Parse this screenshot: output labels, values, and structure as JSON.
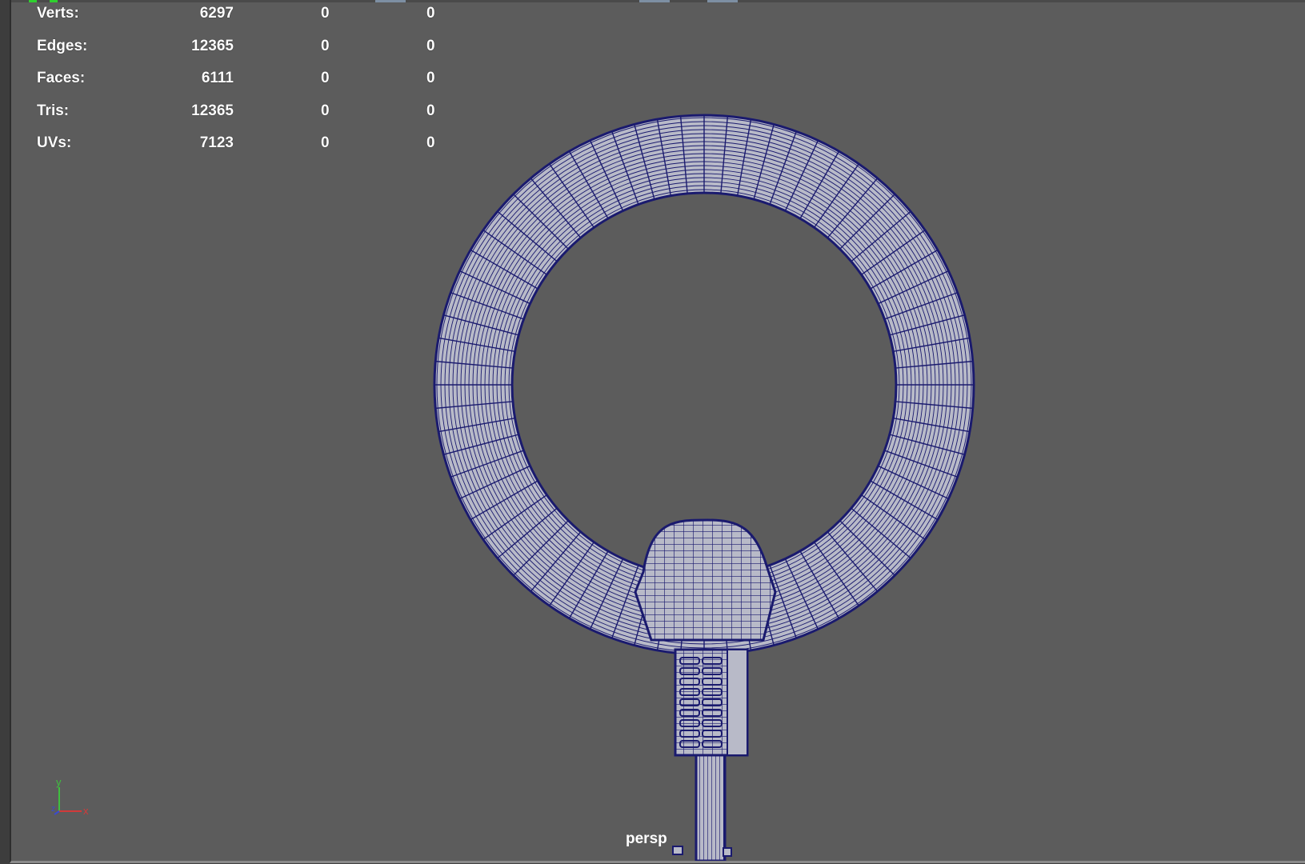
{
  "viewport": {
    "camera": "persp"
  },
  "hud": {
    "rows": [
      {
        "label": "Verts:",
        "c1": "6297",
        "c2": "0",
        "c3": "0"
      },
      {
        "label": "Edges:",
        "c1": "12365",
        "c2": "0",
        "c3": "0"
      },
      {
        "label": "Faces:",
        "c1": "6111",
        "c2": "0",
        "c3": "0"
      },
      {
        "label": "Tris:",
        "c1": "12365",
        "c2": "0",
        "c3": "0"
      },
      {
        "label": "UVs:",
        "c1": "7123",
        "c2": "0",
        "c3": "0"
      }
    ]
  },
  "axis": {
    "y": "y",
    "x": "x",
    "z": "z"
  },
  "colors": {
    "viewport_bg": "#5c5c5c",
    "wire": "#1a1a6e",
    "mesh_fill": "#b8bac8",
    "axis_y": "#3fbf3f",
    "axis_x": "#d23a3a",
    "axis_z": "#3a4ad2"
  }
}
